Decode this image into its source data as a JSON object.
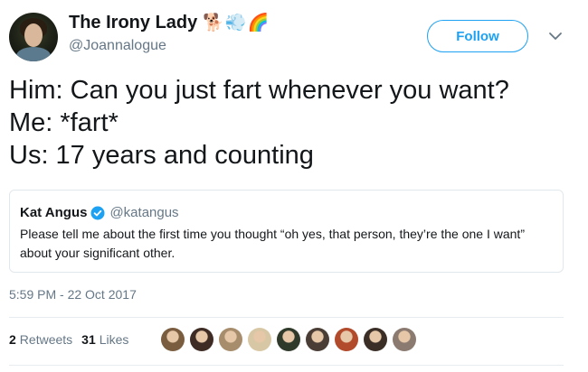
{
  "author": {
    "name": "The Irony Lady",
    "handle": "@Joannalogue",
    "name_emojis": [
      "dog-emoji",
      "dash-emoji",
      "rainbow-emoji"
    ]
  },
  "follow_label": "Follow",
  "tweet_lines": [
    "Him: Can you just fart whenever you want?",
    "Me: *fart*",
    "Us: 17 years and counting"
  ],
  "quoted": {
    "name": "Kat Angus",
    "handle": "@katangus",
    "text": "Please tell me about the first time you thought “oh yes, that person, they’re the one I want” about your significant other.",
    "verified_color": "#1da1f2"
  },
  "timestamp": "5:59 PM - 22 Oct 2017",
  "stats": {
    "retweets_count": "2",
    "retweets_label": "Retweets",
    "likes_count": "31",
    "likes_label": "Likes"
  },
  "liker_avatar_colors": [
    "#7a5c3e",
    "#3d2b24",
    "#a78d6b",
    "#d8c7a4",
    "#2f3a2a",
    "#4a3d35",
    "#b24a2c",
    "#3b2e26",
    "#8a7a70"
  ],
  "colors": {
    "accent": "#1da1f2",
    "muted": "#657786",
    "text": "#14171a",
    "border": "#e1e8ed"
  }
}
